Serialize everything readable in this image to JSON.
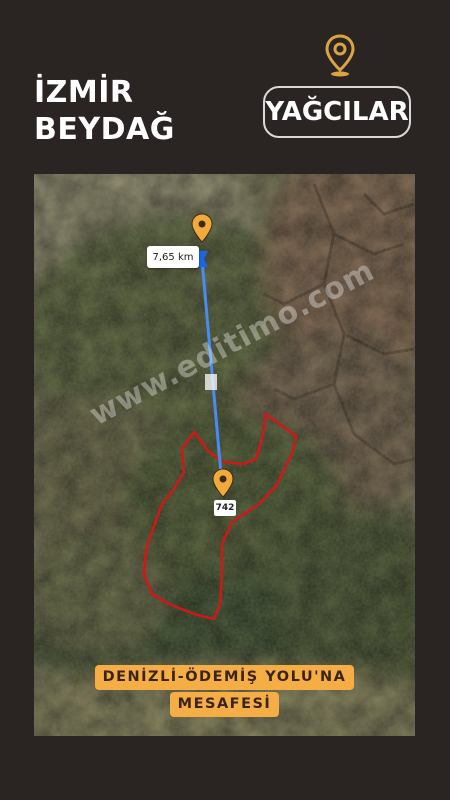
{
  "header": {
    "title_line1": "İZMİR",
    "title_line2": "BEYDAĞ",
    "location_label": "YAĞCILAR",
    "pin_icon": "location-pin-icon",
    "pin_color": "#e0a83a"
  },
  "map": {
    "type": "satellite",
    "distance_label": "7,65 km",
    "road_number": "742",
    "watermark": "www.editimo.com",
    "route_color": "#4a8af4",
    "boundary_color": "#d01818",
    "marker_color": "#f2a93b",
    "caption_line1": "DENİZLİ-ÖDEMİŞ YOLU'NA",
    "caption_line2": "MESAFESİ",
    "caption_bg": "#f5ad45"
  }
}
